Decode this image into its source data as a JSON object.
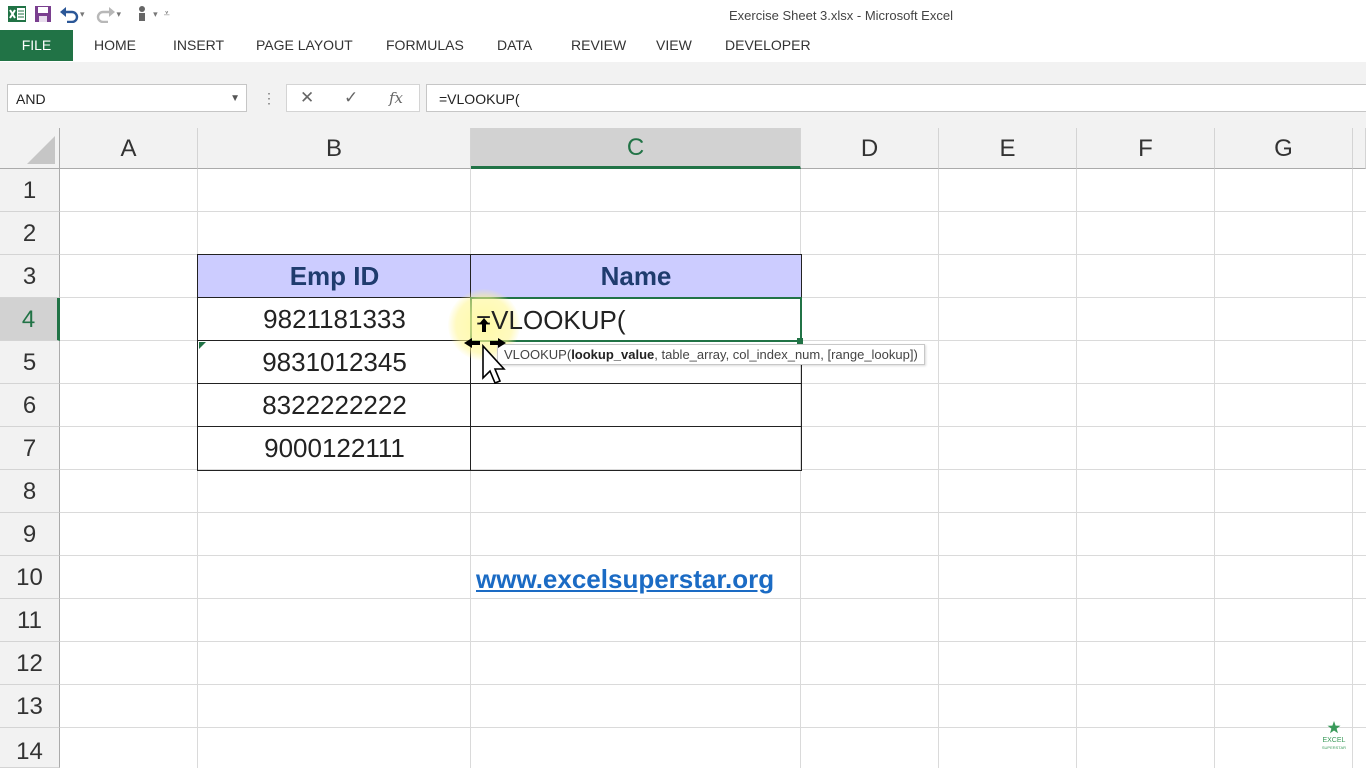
{
  "window": {
    "title": "Exercise Sheet 3.xlsx - Microsoft Excel"
  },
  "qat": {
    "icons": [
      "excel-logo-icon",
      "save-icon",
      "undo-icon",
      "redo-icon",
      "touch-mode-icon",
      "customize-qat-icon"
    ],
    "colors": {
      "excel_green": "#217346",
      "save_purple": "#7a3f8f",
      "undo_blue": "#2b5797"
    }
  },
  "ribbon": {
    "tabs": [
      "FILE",
      "HOME",
      "INSERT",
      "PAGE LAYOUT",
      "FORMULAS",
      "DATA",
      "REVIEW",
      "VIEW",
      "DEVELOPER"
    ]
  },
  "formula_bar": {
    "name_box": "AND",
    "cancel_icon": "cancel-icon",
    "enter_icon": "check-icon",
    "fx_label": "fx",
    "formula": "=VLOOKUP("
  },
  "sheet": {
    "columns": [
      "A",
      "B",
      "C",
      "D",
      "E",
      "F",
      "G"
    ],
    "rows": [
      "1",
      "2",
      "3",
      "4",
      "5",
      "6",
      "7",
      "8",
      "9",
      "10",
      "11",
      "12",
      "13",
      "14"
    ],
    "selected_column": "C",
    "selected_row": "4",
    "table": {
      "headers": [
        "Emp ID",
        "Name"
      ],
      "emp_ids": [
        "9821181333",
        "9831012345",
        "8322222222",
        "9000122111"
      ],
      "header_fill": "#ccccff",
      "header_text_color": "#1f3c6e"
    },
    "editing_cell": {
      "ref": "C4",
      "value": "=VLOOKUP("
    },
    "tooltip": {
      "func": "VLOOKUP(",
      "arg_bold": "lookup_value",
      "rest": ", table_array, col_index_num, [range_lookup])"
    },
    "link": "www.excelsuperstar.org",
    "link_color": "#1b6bc4"
  },
  "watermark": {
    "line1": "EXCEL",
    "line2": "SUPERSTAR"
  }
}
